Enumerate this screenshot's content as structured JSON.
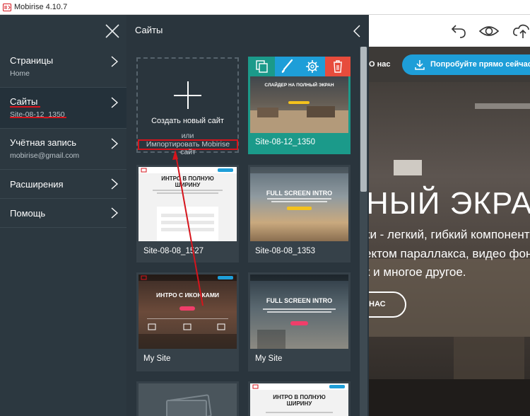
{
  "window": {
    "title": "Mobirise 4.10.7"
  },
  "menu": {
    "items": [
      {
        "label": "Страницы",
        "sub": "Home"
      },
      {
        "label": "Сайты",
        "sub": "Site-08-12_1350"
      },
      {
        "label": "Учётная запись",
        "sub": "mobirise@gmail.com"
      },
      {
        "label": "Расширения",
        "sub": ""
      },
      {
        "label": "Помощь",
        "sub": ""
      }
    ]
  },
  "panel": {
    "title": "Сайты",
    "create_label": "Создать новый сайт",
    "or_label": "или",
    "import_label": "Импортировать Mobirise сайт",
    "sites": [
      {
        "name": "Site-08-12_1350",
        "thumb_title": "СЛАЙДЕР НА ПОЛНЫЙ ЭКРАН"
      },
      {
        "name": "Site-08-08_1527",
        "thumb_title": "ИНТРО В ПОЛНУЮ ШИРИНУ"
      },
      {
        "name": "Site-08-08_1353",
        "thumb_title": "FULL SCREEN INTRO"
      },
      {
        "name": "My Site",
        "thumb_title": "ИНТРО С ИКОНКАМИ"
      },
      {
        "name": "My Site",
        "thumb_title": "FULL SCREEN INTRO"
      },
      {
        "name": "",
        "thumb_title": ""
      },
      {
        "name": "",
        "thumb_title": "ИНТРО В ПОЛНУЮ ШИРИНУ"
      }
    ]
  },
  "preview": {
    "nav_text": "О нас",
    "try_button": "Попробуйте прямо сейчас",
    "hero_title": "НЫЙ ЭКРАН",
    "hero_lines": [
      "ки - легкий, гибкий компонент",
      "ектом параллакса, видео фоны",
      "к и многое другое."
    ],
    "hero_button": "НАС"
  },
  "colors": {
    "accent_teal": "#1b9a8a",
    "delete_red": "#e74c3c",
    "blue": "#1e9ed8",
    "annotation_red": "#d6141c"
  }
}
